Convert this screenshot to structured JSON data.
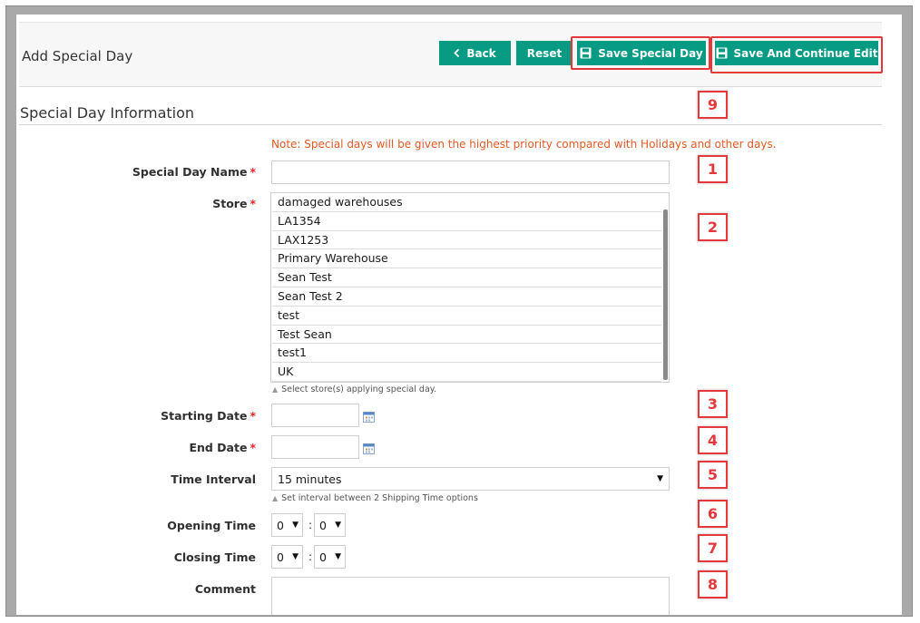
{
  "header": {
    "title": "Add Special Day",
    "buttons": {
      "back": "Back",
      "reset": "Reset",
      "save": "Save Special Day",
      "save_continue": "Save And Continue Edit"
    }
  },
  "section": {
    "title": "Special Day Information"
  },
  "note": "Note: Special days will be given the highest priority compared with Holidays and other days.",
  "form": {
    "name": {
      "label": "Special Day Name",
      "required_mark": "*",
      "value": ""
    },
    "store": {
      "label": "Store",
      "required_mark": "*",
      "options": [
        "damaged warehouses",
        "LA1354",
        "LAX1253",
        "Primary Warehouse",
        "Sean Test",
        "Sean Test 2",
        "test",
        "Test Sean",
        "test1",
        "UK"
      ],
      "hint": "Select store(s) applying special day."
    },
    "starting_date": {
      "label": "Starting Date",
      "required_mark": "*",
      "value": ""
    },
    "end_date": {
      "label": "End Date",
      "required_mark": "*",
      "value": ""
    },
    "time_interval": {
      "label": "Time Interval",
      "value": "15 minutes",
      "hint": "Set interval between 2 Shipping Time options"
    },
    "opening_time": {
      "label": "Opening Time",
      "hour": "0",
      "minute": "0",
      "separator": ":"
    },
    "closing_time": {
      "label": "Closing Time",
      "hour": "0",
      "minute": "0",
      "separator": ":"
    },
    "comment": {
      "label": "Comment",
      "value": ""
    }
  },
  "callouts": [
    "1",
    "2",
    "3",
    "4",
    "5",
    "6",
    "7",
    "8",
    "9"
  ],
  "icons": {
    "back": "chevron-left-icon",
    "save": "floppy-disk-icon",
    "calendar": "calendar-icon",
    "dropdown": "caret-down-icon"
  },
  "colors": {
    "primary_button": "#079b84",
    "highlight": "#e5383b",
    "note": "#e35a25",
    "required": "#e22626"
  }
}
